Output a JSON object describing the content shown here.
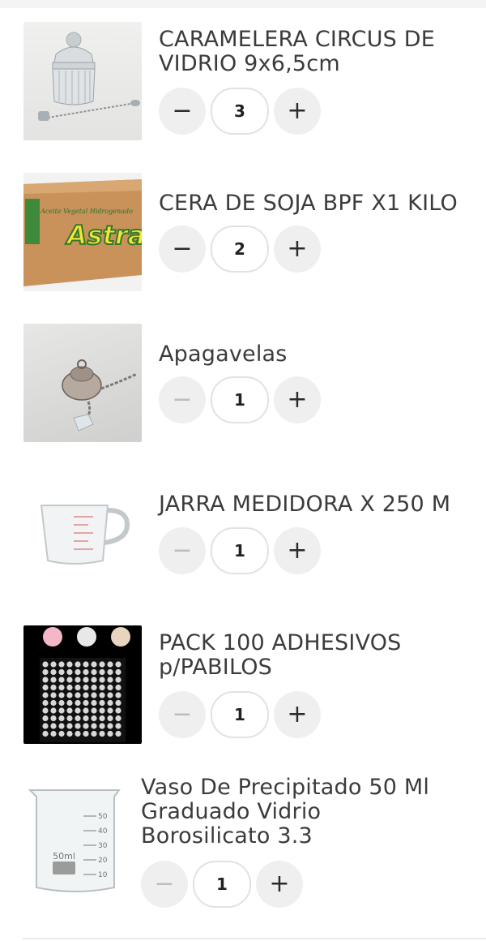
{
  "cart": {
    "items": [
      {
        "title_lines": [
          "CARAMELERA CIRCUS DE",
          "VIDRIO 9x6,5cm"
        ],
        "quantity": "3",
        "decrement_label": "−",
        "increment_label": "+",
        "decrement_enabled": true,
        "image_icon": "glass-candy-jar"
      },
      {
        "title_lines": [
          "CERA DE SOJA BPF X1 KILO"
        ],
        "quantity": "2",
        "decrement_label": "−",
        "increment_label": "+",
        "decrement_enabled": true,
        "image_icon": "cardboard-box",
        "image_text_top": "Aceite Vegetal Hidrogenado",
        "image_text_brand": "Astra"
      },
      {
        "title_lines": [
          "Apagavelas"
        ],
        "quantity": "1",
        "decrement_label": "−",
        "increment_label": "+",
        "decrement_enabled": false,
        "image_icon": "candle-snuffer"
      },
      {
        "title_lines": [
          "JARRA MEDIDORA X 250 M"
        ],
        "quantity": "1",
        "decrement_label": "−",
        "increment_label": "+",
        "decrement_enabled": false,
        "image_icon": "measuring-jug"
      },
      {
        "title_lines": [
          "PACK 100 ADHESIVOS",
          "p/PABILOS"
        ],
        "quantity": "1",
        "decrement_label": "−",
        "increment_label": "+",
        "decrement_enabled": false,
        "image_icon": "adhesive-dots-sheet"
      },
      {
        "title_lines": [
          "Vaso De Precipitado 50 Ml",
          "Graduado Vidrio",
          "Borosilicato 3.3"
        ],
        "quantity": "1",
        "decrement_label": "−",
        "increment_label": "+",
        "decrement_enabled": false,
        "image_icon": "glass-beaker",
        "image_text_label": "50ml",
        "image_scale": [
          "50",
          "40",
          "30",
          "20",
          "10"
        ]
      }
    ]
  }
}
